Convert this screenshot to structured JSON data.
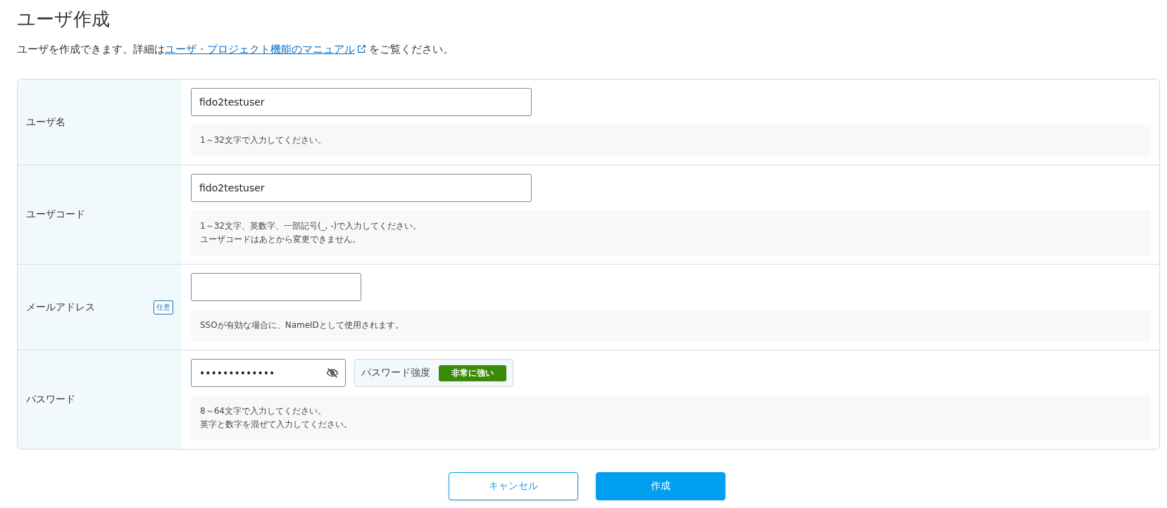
{
  "page": {
    "title": "ユーザ作成",
    "description": {
      "before": "ユーザを作成できます。詳細は",
      "link": "ユーザ・プロジェクト機能のマニュアル",
      "after": "をご覧ください。"
    }
  },
  "form": {
    "rows": [
      {
        "kind": "text",
        "label": "ユーザ名",
        "value": "fido2testuser",
        "hint": [
          "1～32文字で入力してください。"
        ]
      },
      {
        "kind": "text",
        "label": "ユーザコード",
        "value": "fido2testuser",
        "hint": [
          "1～32文字、英数字、一部記号(_, -)で入力してください。",
          "ユーザコードはあとから変更できません。"
        ]
      },
      {
        "kind": "email",
        "label": "メールアドレス",
        "badge": "任意",
        "hint": [
          "SSOが有効な場合に、NameIDとして使用されます。"
        ]
      },
      {
        "kind": "password",
        "label": "パスワード",
        "value": "•••••••••••••",
        "strength": {
          "label": "パスワード強度",
          "value": "非常に強い"
        },
        "hint": [
          "8～64文字で入力してください。",
          "英字と数字を混ぜて入力してください。"
        ]
      }
    ]
  },
  "buttons": [
    {
      "kind": "secondary",
      "label": "キャンセル"
    },
    {
      "kind": "primary",
      "label": "作成"
    }
  ]
}
